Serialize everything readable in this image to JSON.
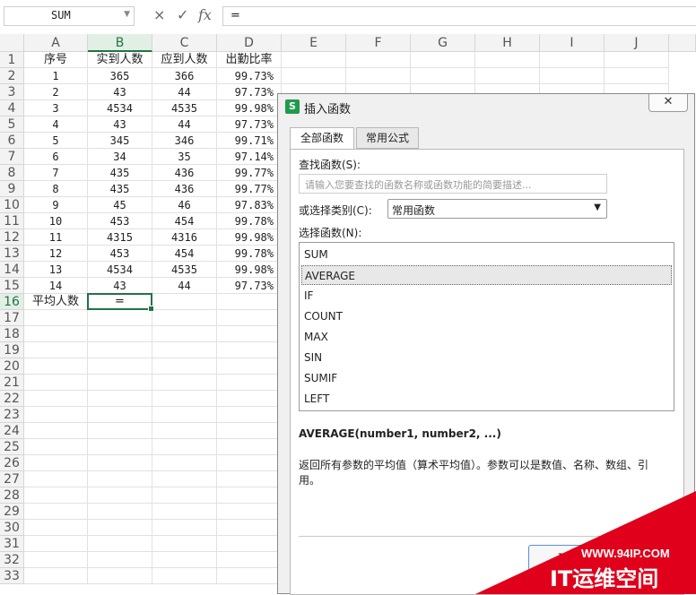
{
  "formula_bar": {
    "name_box": "SUM",
    "cancel_icon": "×",
    "enter_icon": "✓",
    "fx_icon": "fx",
    "formula": "="
  },
  "sheet": {
    "columns": [
      "A",
      "B",
      "C",
      "D",
      "E",
      "F",
      "G",
      "H",
      "I",
      "J"
    ],
    "selected_column": "B",
    "row_numbers": [
      "1",
      "2",
      "3",
      "4",
      "5",
      "6",
      "7",
      "8",
      "9",
      "10",
      "11",
      "12",
      "13",
      "14",
      "15",
      "16",
      "17",
      "18",
      "19",
      "20",
      "21",
      "22",
      "23",
      "24",
      "25",
      "26",
      "27",
      "28",
      "29",
      "30",
      "31",
      "32",
      "33"
    ],
    "selected_row": "16",
    "headers": [
      "序号",
      "实到人数",
      "应到人数",
      "出勤比率"
    ],
    "rows": [
      [
        "1",
        "365",
        "366",
        "99.73%"
      ],
      [
        "2",
        "43",
        "44",
        "97.73%"
      ],
      [
        "3",
        "4534",
        "4535",
        "99.98%"
      ],
      [
        "4",
        "43",
        "44",
        "97.73%"
      ],
      [
        "5",
        "345",
        "346",
        "99.71%"
      ],
      [
        "6",
        "34",
        "35",
        "97.14%"
      ],
      [
        "7",
        "435",
        "436",
        "99.77%"
      ],
      [
        "8",
        "435",
        "436",
        "99.77%"
      ],
      [
        "9",
        "45",
        "46",
        "97.83%"
      ],
      [
        "10",
        "453",
        "454",
        "99.78%"
      ],
      [
        "11",
        "4315",
        "4316",
        "99.98%"
      ],
      [
        "12",
        "453",
        "454",
        "99.78%"
      ],
      [
        "13",
        "4534",
        "4535",
        "99.98%"
      ],
      [
        "14",
        "43",
        "44",
        "97.73%"
      ]
    ],
    "row16": {
      "label": "平均人数",
      "value": "="
    }
  },
  "dialog": {
    "logo": "S",
    "title": "插入函数",
    "close": "✕",
    "tabs": [
      "全部函数",
      "常用公式"
    ],
    "search_label": "查找函数(S):",
    "search_placeholder": "请输入您要查找的函数名称或函数功能的简要描述...",
    "category_label": "或选择类别(C):",
    "category_value": "常用函数",
    "category_arrow": "▼",
    "function_label": "选择函数(N):",
    "functions": [
      "SUM",
      "AVERAGE",
      "IF",
      "COUNT",
      "MAX",
      "SIN",
      "SUMIF",
      "LEFT"
    ],
    "selected_function": "AVERAGE",
    "signature": "AVERAGE(number1, number2, ...)",
    "description": "返回所有参数的平均值（算术平均值）。参数可以是数值、名称、数组、引用。",
    "ok": "确定"
  },
  "watermark": {
    "url": "WWW.94IP.COM",
    "brand": "IT运维空间",
    "color": "#e0001b"
  }
}
